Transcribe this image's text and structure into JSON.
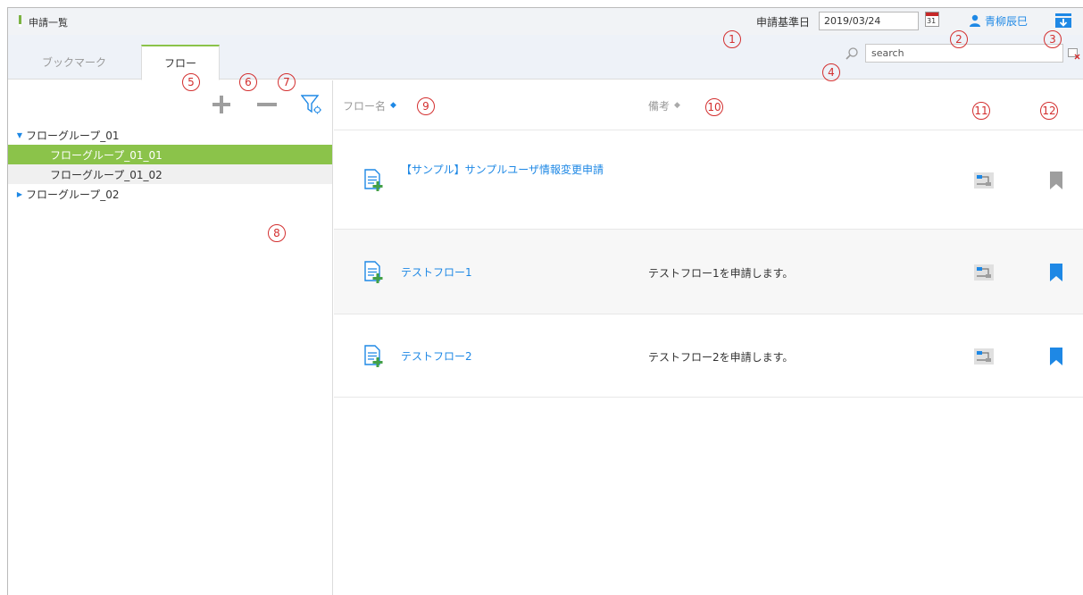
{
  "window": {
    "title": "申請一覧"
  },
  "header": {
    "basedate_label": "申請基準日",
    "basedate_value": "2019/03/24",
    "calendar_day": "31",
    "user_name": "青柳辰巳"
  },
  "tabs": [
    {
      "label": "ブックマーク",
      "active": false
    },
    {
      "label": "フロー",
      "active": true
    }
  ],
  "search": {
    "placeholder": "search"
  },
  "tree": {
    "groups": [
      {
        "label": "フローグループ_01",
        "expanded": true,
        "children": [
          {
            "label": "フローグループ_01_01",
            "selected": true
          },
          {
            "label": "フローグループ_01_02",
            "selected": false
          }
        ]
      },
      {
        "label": "フローグループ_02",
        "expanded": false,
        "children": []
      }
    ]
  },
  "list": {
    "columns": {
      "name": "フロー名",
      "note": "備考"
    },
    "rows": [
      {
        "name": "【サンプル】サンプルユーザ情報変更申請",
        "note": "",
        "bookmarked": false
      },
      {
        "name": "テストフロー1",
        "note": "テストフロー1を申請します。",
        "bookmarked": true
      },
      {
        "name": "テストフロー2",
        "note": "テストフロー2を申請します。",
        "bookmarked": true
      }
    ]
  },
  "callouts": [
    "1",
    "2",
    "3",
    "4",
    "5",
    "6",
    "7",
    "8",
    "9",
    "10",
    "11",
    "12"
  ],
  "colors": {
    "accent_green": "#8bc34a",
    "link_blue": "#1e88e5",
    "bookmark_on": "#1e88e5",
    "bookmark_off": "#9e9e9e",
    "callout_red": "#d32f2f"
  }
}
